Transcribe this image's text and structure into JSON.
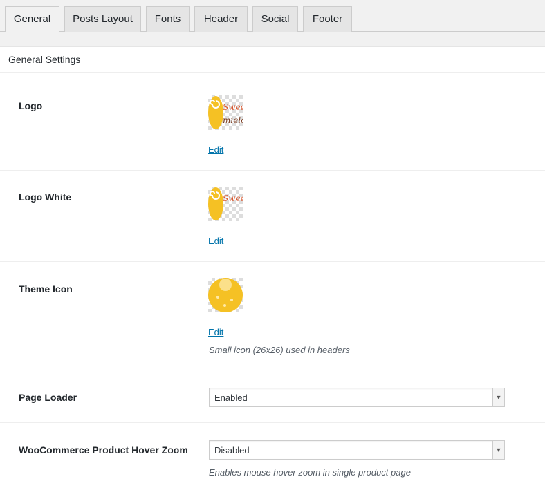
{
  "tabs": [
    "General",
    "Posts Layout",
    "Fonts",
    "Header",
    "Social",
    "Footer"
  ],
  "section_title": "General Settings",
  "logo": {
    "label": "Logo",
    "thumb_text_1": "Sweet",
    "thumb_text_2": "mielo",
    "edit": "Edit"
  },
  "logo_white": {
    "label": "Logo White",
    "thumb_text_1": "Sweet",
    "edit": "Edit"
  },
  "theme_icon": {
    "label": "Theme Icon",
    "edit": "Edit",
    "description": "Small icon (26x26) used in headers"
  },
  "page_loader": {
    "label": "Page Loader",
    "value": "Enabled"
  },
  "hover_zoom": {
    "label": "WooCommerce Product Hover Zoom",
    "value": "Disabled",
    "description": "Enables mouse hover zoom in single product page"
  },
  "colors": {
    "link": "#0073aa",
    "logo_yellow": "#f5c124",
    "logo_orange": "#d9552b",
    "logo_brown": "#7a3b1f"
  }
}
